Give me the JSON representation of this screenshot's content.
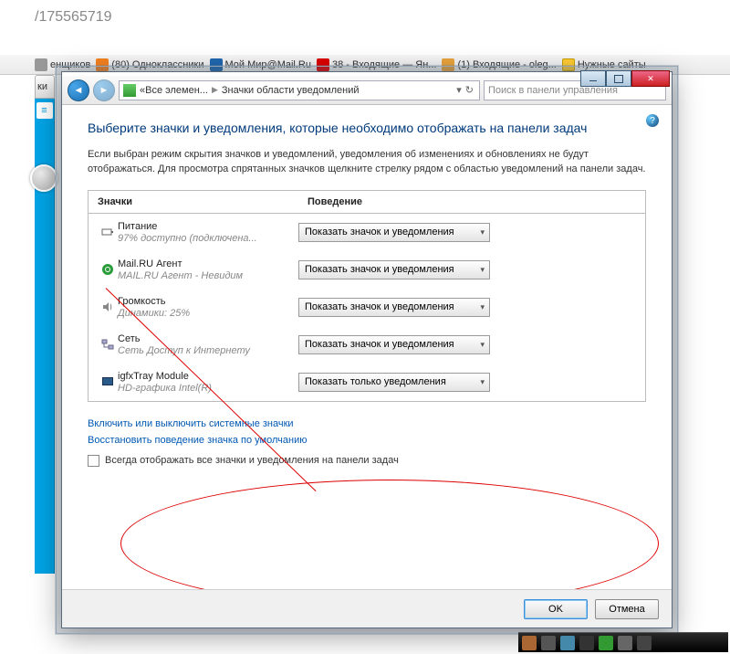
{
  "url_fragment": "/175565719",
  "bookmarks": [
    {
      "label": "енщиков",
      "color": "#666"
    },
    {
      "label": "(80) Одноклассники",
      "color": "#f58220"
    },
    {
      "label": "Мой Мир@Mail.Ru",
      "color": "#2067b0"
    },
    {
      "label": "38 - Входящие — Ян...",
      "color": "#d00"
    },
    {
      "label": "(1) Входящие - oleg...",
      "color": "#e8a33d"
    },
    {
      "label": "Нужные сайты",
      "color": "#ffcc33"
    }
  ],
  "tab_fragment": "ки",
  "window": {
    "nav": {
      "crumb1": "Все элемен...",
      "crumb2": "Значки области уведомлений",
      "search_placeholder": "Поиск в панели управления"
    },
    "heading": "Выберите значки и уведомления, которые необходимо отображать на панели задач",
    "description": "Если выбран режим скрытия значков и уведомлений, уведомления об изменениях и обновлениях не будут отображаться. Для просмотра спрятанных значков щелкните стрелку рядом с областью уведомлений на панели задач.",
    "col_icons": "Значки",
    "col_behavior": "Поведение",
    "rows": [
      {
        "title": "Питание",
        "sub": "97% доступно (подключена...",
        "sel": "Показать значок и уведомления"
      },
      {
        "title": "Mail.RU Агент",
        "sub": "MAIL.RU Агент - Невидим",
        "sel": "Показать значок и уведомления"
      },
      {
        "title": "Громкость",
        "sub": "Динамики: 25%",
        "sel": "Показать значок и уведомления"
      },
      {
        "title": "Сеть",
        "sub": "Сеть Доступ к Интернету",
        "sel": "Показать значок и уведомления"
      },
      {
        "title": "igfxTray Module",
        "sub": "HD-графика Intel(R)",
        "sel": "Показать только уведомления"
      }
    ],
    "link1": "Включить или выключить системные значки",
    "link2": "Восстановить поведение значка по умолчанию",
    "checkbox_label": "Всегда отображать все значки и уведомления на панели задач",
    "ok": "OK",
    "cancel": "Отмена"
  }
}
